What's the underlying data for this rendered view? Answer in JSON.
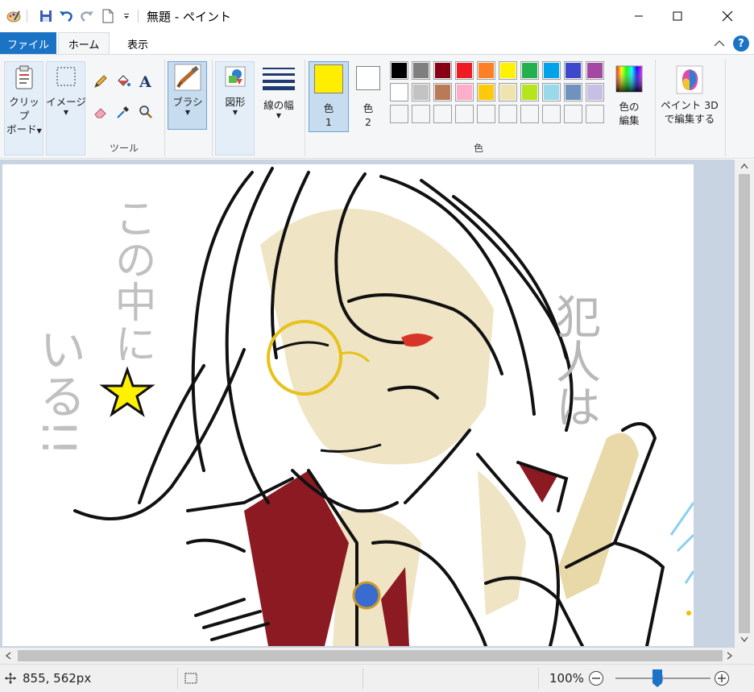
{
  "window": {
    "title": "無題 - ペイント"
  },
  "menu": {
    "file": "ファイル",
    "tabs": [
      {
        "label": "ホーム",
        "active": true
      },
      {
        "label": "表示",
        "active": false
      }
    ],
    "help": "?"
  },
  "ribbon": {
    "clipboard": {
      "line1": "クリップ",
      "line2": "ボード"
    },
    "image": {
      "label": "イメージ"
    },
    "tools_label": "ツール",
    "brush": {
      "label": "ブラシ"
    },
    "shapes": {
      "label": "図形"
    },
    "line_width": {
      "label": "線の幅"
    },
    "color1": {
      "line1": "色",
      "line2": "1",
      "value": "#ffee00"
    },
    "color2": {
      "line1": "色",
      "line2": "2",
      "value": "#ffffff"
    },
    "colors_label": "色",
    "edit_colors": {
      "line1": "色の",
      "line2": "編集"
    },
    "paint3d": {
      "line1": "ペイント 3D",
      "line2": "で編集する"
    },
    "palette_row1": [
      "#000000",
      "#7f7f7f",
      "#880015",
      "#ed1c24",
      "#ff7f27",
      "#fff200",
      "#22b14c",
      "#00a2e8",
      "#3f48cc",
      "#a349a4"
    ],
    "palette_row2": [
      "#ffffff",
      "#c3c3c3",
      "#b97a57",
      "#ffaec9",
      "#ffc90e",
      "#efe4b0",
      "#b5e61d",
      "#99d9ea",
      "#7092be",
      "#c8bfe7"
    ]
  },
  "canvas": {
    "text_right": "犯人は",
    "text_left_a": "この中に",
    "text_left_b": "いる!!"
  },
  "status": {
    "cursor_pos": "855, 562px",
    "zoom": "100%"
  }
}
